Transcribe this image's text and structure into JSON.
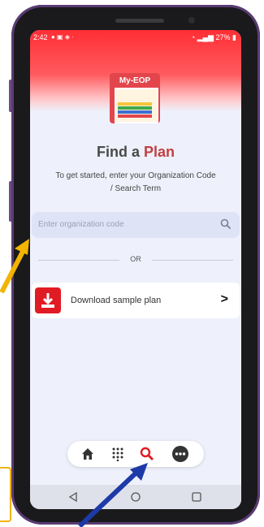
{
  "status_bar": {
    "time": "2:42",
    "battery": "27%"
  },
  "logo": {
    "text": "My-EOP"
  },
  "heading": {
    "find_a": "Find a ",
    "plan": "Plan"
  },
  "subtitle": "To get started, enter your Organization Code / Search Term",
  "search": {
    "placeholder": "Enter organization code"
  },
  "divider": {
    "text": "OR"
  },
  "sample_card": {
    "label": "Download sample plan"
  },
  "bottom_nav": {
    "items": [
      "home-icon",
      "keypad-icon",
      "search-icon",
      "more-icon"
    ],
    "active_color": "#e11b24"
  },
  "colors": {
    "accent_red": "#e11b24",
    "annotation_yellow": "#f2b400",
    "annotation_blue": "#1d3aa8"
  }
}
